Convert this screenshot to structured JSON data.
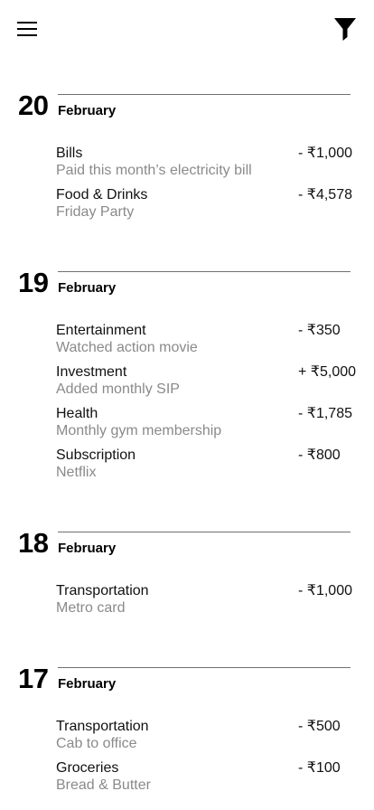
{
  "header": {
    "menu_icon": "hamburger-menu-icon",
    "filter_icon": "filter-funnel-icon"
  },
  "days": [
    {
      "day": "20",
      "month": "February",
      "transactions": [
        {
          "category": "Bills",
          "note": "Paid this month’s electricity bill",
          "amount": "- ₹1,000"
        },
        {
          "category": "Food & Drinks",
          "note": "Friday Party",
          "amount": "- ₹4,578"
        }
      ]
    },
    {
      "day": "19",
      "month": "February",
      "transactions": [
        {
          "category": "Entertainment",
          "note": "Watched action movie",
          "amount": "- ₹350"
        },
        {
          "category": "Investment",
          "note": "Added monthly SIP",
          "amount": "+ ₹5,000"
        },
        {
          "category": "Health",
          "note": "Monthly gym membership",
          "amount": "- ₹1,785"
        },
        {
          "category": "Subscription",
          "note": "Netflix",
          "amount": "- ₹800"
        }
      ]
    },
    {
      "day": "18",
      "month": "February",
      "transactions": [
        {
          "category": "Transportation",
          "note": "Metro card",
          "amount": "- ₹1,000"
        }
      ]
    },
    {
      "day": "17",
      "month": "February",
      "transactions": [
        {
          "category": "Transportation",
          "note": "Cab to office",
          "amount": "- ₹500"
        },
        {
          "category": "Groceries",
          "note": "Bread & Butter",
          "amount": "- ₹100"
        }
      ]
    }
  ]
}
